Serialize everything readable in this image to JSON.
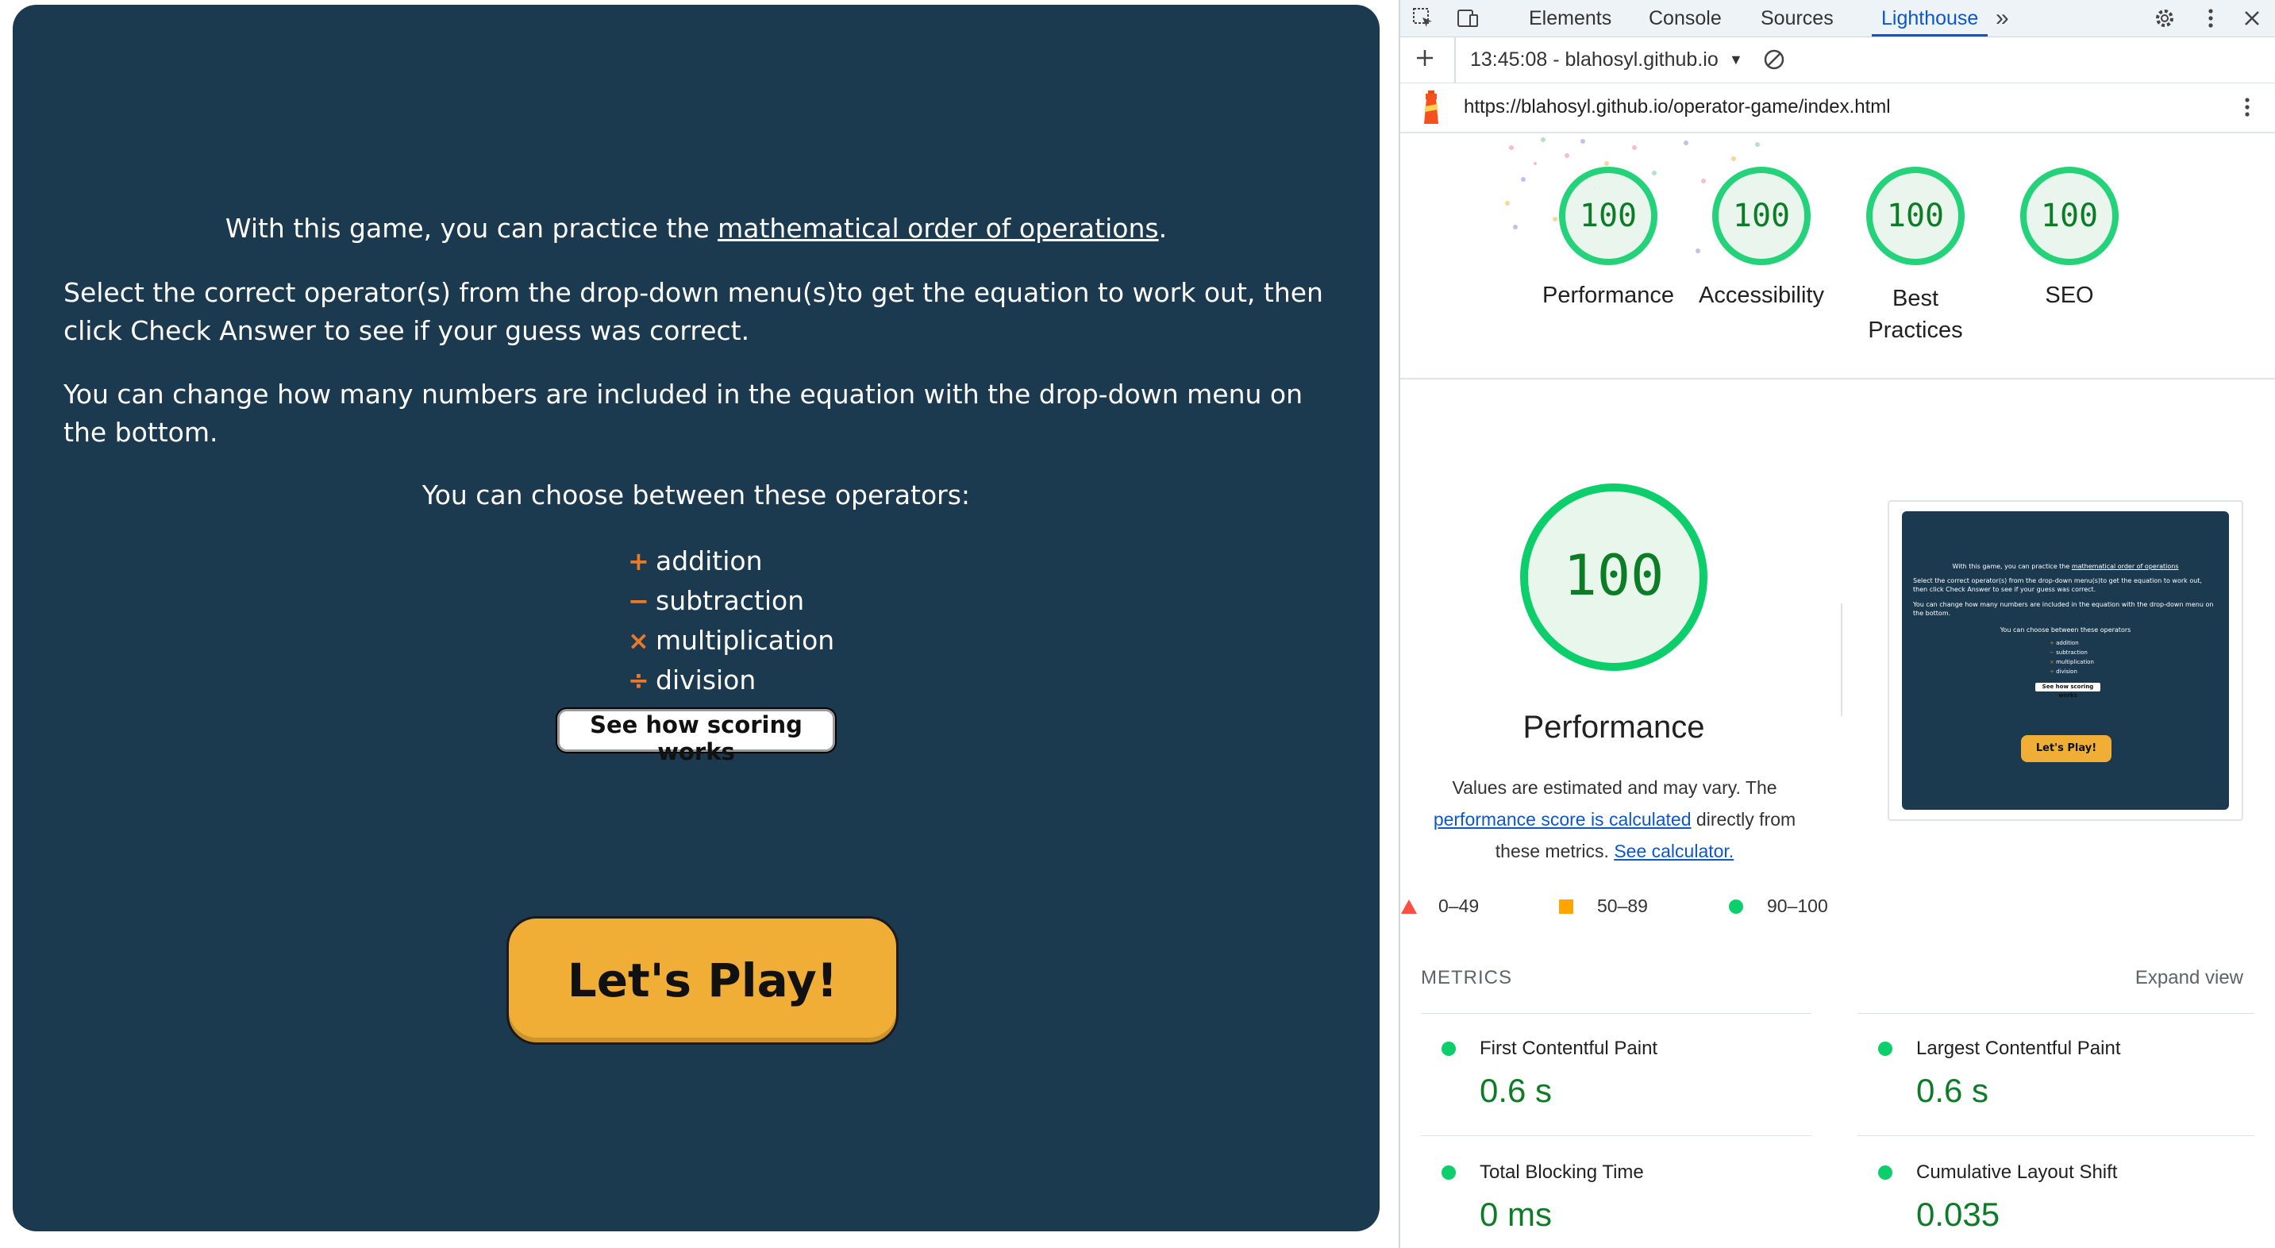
{
  "game": {
    "intro_prefix": "With this game, you can practice the ",
    "intro_link": "mathematical order of operations",
    "intro_suffix": ".",
    "para1": "Select the correct operator(s) from the drop-down menu(s)to get the equation to work out, then click Check Answer to see if your guess was correct.",
    "para2": "You can change how many numbers are included in the equation with the drop-down menu on the bottom.",
    "choose": "You can choose between these operators:",
    "operators": [
      {
        "symbol": "+",
        "label": "addition",
        "icon": "plus-icon"
      },
      {
        "symbol": "−",
        "label": "subtraction",
        "icon": "minus-icon"
      },
      {
        "symbol": "×",
        "label": "multiplication",
        "icon": "times-icon"
      },
      {
        "symbol": "÷",
        "label": "division",
        "icon": "divide-icon"
      }
    ],
    "scoring_button": "See how scoring works",
    "play_button": "Let's Play!",
    "colors": {
      "background": "#1b3a50",
      "accent": "#f0ae36",
      "operator_icon": "#e8792b"
    }
  },
  "devtools": {
    "tabs": [
      "Elements",
      "Console",
      "Sources",
      "Lighthouse"
    ],
    "active_tab": "Lighthouse",
    "overflow": "»",
    "report_label": "13:45:08 - blahosyl.github.io",
    "url": "https://blahosyl.github.io/operator-game/index.html",
    "scores": [
      {
        "value": "100",
        "label": "Performance"
      },
      {
        "value": "100",
        "label": "Accessibility"
      },
      {
        "value": "100",
        "label": "Best Practices"
      },
      {
        "value": "100",
        "label": "SEO"
      }
    ],
    "main_score": "100",
    "main_title": "Performance",
    "desc_prefix": "Values are estimated and may vary. The ",
    "desc_link": "performance score is calculated",
    "desc_middle": " directly from these metrics. ",
    "desc_link2": "See calculator.",
    "legend": [
      "0–49",
      "50–89",
      "90–100"
    ],
    "metrics_heading": "METRICS",
    "expand": "Expand view",
    "metrics": [
      {
        "name": "First Contentful Paint",
        "value": "0.6 s"
      },
      {
        "name": "Largest Contentful Paint",
        "value": "0.6 s"
      },
      {
        "name": "Total Blocking Time",
        "value": "0 ms"
      },
      {
        "name": "Cumulative Layout Shift",
        "value": "0.035"
      }
    ],
    "colors": {
      "pass": "#0cce6b",
      "average": "#ffa400",
      "fail": "#ff4e42",
      "link": "#0b57d0",
      "value": "#0c7d26"
    },
    "thumb": {
      "intro_prefix": "With this game, you can practice the ",
      "intro_link": "mathematical order of operations",
      "para1": "Select the correct operator(s) from the drop-down menu(s)to get the equation to work out, then click Check Answer to see if your guess was correct.",
      "para2": "You can change how many numbers are included in the equation with the drop-down menu on the bottom.",
      "choose": "You can choose between these operators",
      "ops": [
        "addition",
        "subtraction",
        "multiplication",
        "division"
      ],
      "scoring": "See how scoring works",
      "play": "Let's Play!"
    }
  }
}
